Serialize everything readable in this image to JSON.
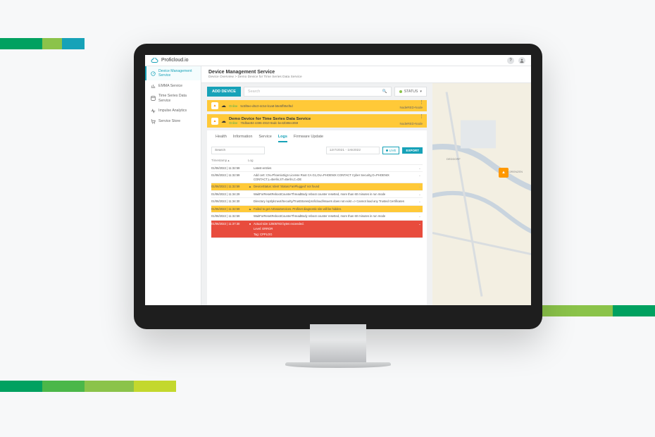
{
  "brand": "Proficloud.io",
  "top": {
    "help": "?",
    "user": "👤"
  },
  "sidebar": {
    "items": [
      {
        "label": "Device Management Service"
      },
      {
        "label": "EMMA Service"
      },
      {
        "label": "Time Series Data Service"
      },
      {
        "label": "Impulse Analytics"
      },
      {
        "label": "Service Store"
      }
    ]
  },
  "header": {
    "title": "Device Management Service",
    "breadcrumb": "Device Overview > Demo Device for Time Series Data Service"
  },
  "toolbar": {
    "add": "ADD DEVICE",
    "search_placeholder": "Search",
    "status": "STATUS"
  },
  "devices": [
    {
      "online": "Online",
      "uuid": "5c5f8ee-d6c0-4c54-b1a8-b8e5ff854f5d",
      "node": "NodeRED-Node"
    },
    {
      "name": "Demo Device for Time Series Data Service",
      "online": "Online",
      "uuid": "70dbae84-4496-4910-9adc-be42b98ec859",
      "node": "NodeRED-Node"
    }
  ],
  "tabs": [
    "Health",
    "Information",
    "Service",
    "Logs",
    "Firmware Update"
  ],
  "filters": {
    "search_placeholder": "Search",
    "date": "12/7/2021 - 1/6/2022",
    "live": "LIVE",
    "export": "EXPORT"
  },
  "cols": {
    "ts": "Timestamp ▴",
    "log": "Log"
  },
  "logs": [
    {
      "ts": "01/06/2022 | 11:32:59",
      "level": "info",
      "msg": "Latest-entries"
    },
    {
      "ts": "01/06/2022 | 11:32:59",
      "level": "info",
      "msg": "Add cert: CN=PhoenixSign License Root CA G1,OU=PHOENIX CONTACT Cyber Security,O=PHOENIX CONTACT,L=Berlin,ST=Berlin,C=DE"
    },
    {
      "ts": "01/06/2022 | 11:32:59",
      "level": "warn",
      "msg": "DeviceStatus: Ident 'Status.FanPlugged' not found"
    },
    {
      "ts": "01/06/2022 | 11:34:29",
      "level": "info",
      "msg": "WaitForResetRebootCounterThreadBody reboot counter resetted, more than 60 minutes in run mode"
    },
    {
      "ts": "01/06/2022 | 11:34:30",
      "level": "info",
      "msg": "Directory /opt/plcnext/Security/TrustStores/proficloud/issuers does not exist => Cannot load any Trusted Certificates"
    },
    {
      "ts": "01/06/2022 | 11:32:59",
      "level": "warn",
      "msg": "Failed to get ArDataServices. Profinet diagnostic site will be hidden."
    },
    {
      "ts": "01/06/2022 | 11:32:59",
      "level": "info",
      "msg": "WaitForResetRebootCounterThreadBody reboot counter resetted, more than 60 minutes in run mode"
    },
    {
      "ts": "01/06/2022 | 11:37:30",
      "level": "err",
      "msg": "Actual size 12505783 bytes exceeded.",
      "extra1": "Level: ERROR",
      "extra2": "Tag: CPPLOG"
    }
  ],
  "map": {
    "city1": "DEDDORF",
    "city2": "LORENZEN"
  }
}
